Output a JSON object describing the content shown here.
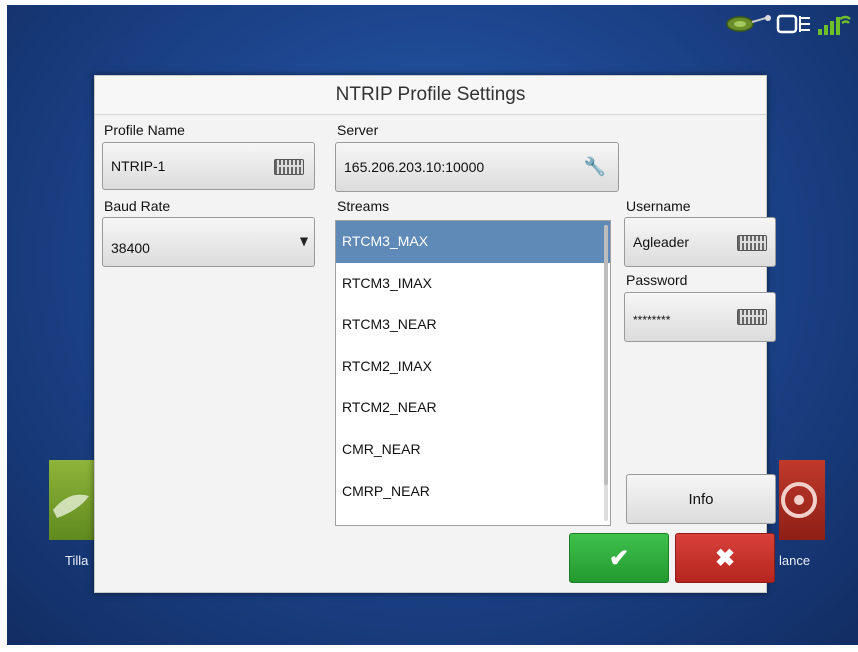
{
  "dialog": {
    "title": "NTRIP Profile Settings"
  },
  "profile_name": {
    "label": "Profile Name",
    "value": "NTRIP-1"
  },
  "server": {
    "label": "Server",
    "value": "165.206.203.10:10000"
  },
  "baud_rate": {
    "label": "Baud Rate",
    "value": "38400"
  },
  "streams": {
    "label": "Streams",
    "items": [
      "RTCM3_MAX",
      "RTCM3_IMAX",
      "RTCM3_NEAR",
      "RTCM2_IMAX",
      "RTCM2_NEAR",
      "CMR_NEAR",
      "CMRP_NEAR"
    ],
    "selected": "RTCM3_MAX"
  },
  "username": {
    "label": "Username",
    "value": "Agleader"
  },
  "password": {
    "label": "Password",
    "value": "********"
  },
  "buttons": {
    "info": "Info",
    "ok_glyph": "✔",
    "cancel_glyph": "✖"
  },
  "background": {
    "left_label": "Tilla",
    "right_label": "lance"
  },
  "icons": [
    "gps-antenna-icon",
    "display-icon",
    "wireless-signal-icon",
    "keyboard-icon",
    "wrench-icon",
    "dropdown-arrow-icon"
  ],
  "colors": {
    "selected_row": "#5f8ab8",
    "ok_button": "#2fae3c",
    "cancel_button": "#c8302a",
    "screen_bg": "#1d468f"
  }
}
